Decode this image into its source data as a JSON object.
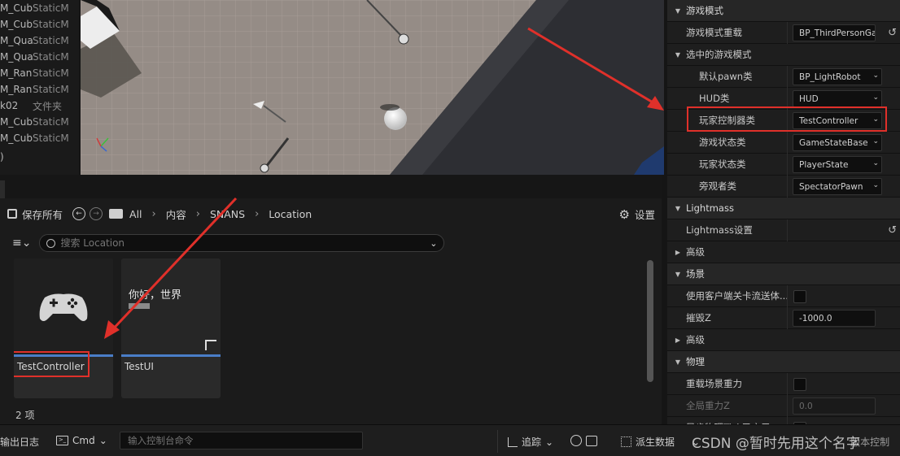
{
  "outliner": {
    "rows": [
      {
        "name": "M_Cub",
        "type": "StaticM"
      },
      {
        "name": "M_Cub",
        "type": "StaticM"
      },
      {
        "name": "M_Qua",
        "type": "StaticM"
      },
      {
        "name": "M_Qua",
        "type": "StaticM"
      },
      {
        "name": "M_Ran",
        "type": "StaticM"
      },
      {
        "name": "M_Ran",
        "type": "StaticM"
      },
      {
        "name": "k02",
        "type": "文件夹"
      },
      {
        "name": "M_Cub",
        "type": "StaticM"
      },
      {
        "name": "M_Cub",
        "type": "StaticM"
      }
    ],
    "footer": ")"
  },
  "content_browser": {
    "save_all": "保存所有",
    "breadcrumb": [
      "All",
      "内容",
      "SNANS",
      "Location"
    ],
    "settings": "设置",
    "search_placeholder": "搜索 Location",
    "assets": [
      {
        "name": "TestController",
        "bar_color": "#4a7ec8",
        "icon": "gamepad-icon"
      },
      {
        "name": "TestUI",
        "bar_color": "#4a7ec8",
        "preview_text": "你好，世界"
      }
    ],
    "item_count": "2 项"
  },
  "details": {
    "rows": [
      {
        "kind": "cat",
        "label": "游戏模式",
        "expanded": true
      },
      {
        "kind": "prop",
        "label": "游戏模式重载",
        "value": "BP_ThirdPersonGa",
        "reset": true
      },
      {
        "kind": "subcat",
        "label": "选中的游戏模式",
        "expanded": true
      },
      {
        "kind": "prop2",
        "label": "默认pawn类",
        "value": "BP_LightRobot"
      },
      {
        "kind": "prop2",
        "label": "HUD类",
        "value": "HUD"
      },
      {
        "kind": "prop2",
        "label": "玩家控制器类",
        "value": "TestController",
        "highlight": true
      },
      {
        "kind": "prop2",
        "label": "游戏状态类",
        "value": "GameStateBase"
      },
      {
        "kind": "prop2",
        "label": "玩家状态类",
        "value": "PlayerState"
      },
      {
        "kind": "prop2",
        "label": "旁观者类",
        "value": "SpectatorPawn"
      },
      {
        "kind": "cat",
        "label": "Lightmass",
        "expanded": true
      },
      {
        "kind": "prop",
        "label": "Lightmass设置",
        "reset": true
      },
      {
        "kind": "subcat",
        "label": "高级",
        "expanded": false
      },
      {
        "kind": "cat",
        "label": "场景",
        "expanded": true
      },
      {
        "kind": "check",
        "label": "使用客户端关卡流送体..."
      },
      {
        "kind": "num",
        "label": "摧毁Z",
        "value": "-1000.0"
      },
      {
        "kind": "subcat",
        "label": "高级",
        "expanded": false
      },
      {
        "kind": "cat",
        "label": "物理",
        "expanded": true
      },
      {
        "kind": "check",
        "label": "重载场景重力"
      },
      {
        "kind": "numdim",
        "label": "全局重力Z",
        "value": "0.0"
      },
      {
        "kind": "check",
        "label": "异步物理Tick已启用"
      }
    ]
  },
  "statusbar": {
    "output_log": "输出日志",
    "cmd": "Cmd",
    "cmd_placeholder": "输入控制台命令",
    "trace": "追踪",
    "derived_data": "派生数据",
    "source_control": "版本控制"
  },
  "watermark": "CSDN @暂时先用这个名字",
  "colors": {
    "highlight_red": "#e0302a",
    "asset_bar": "#4a7ec8"
  }
}
